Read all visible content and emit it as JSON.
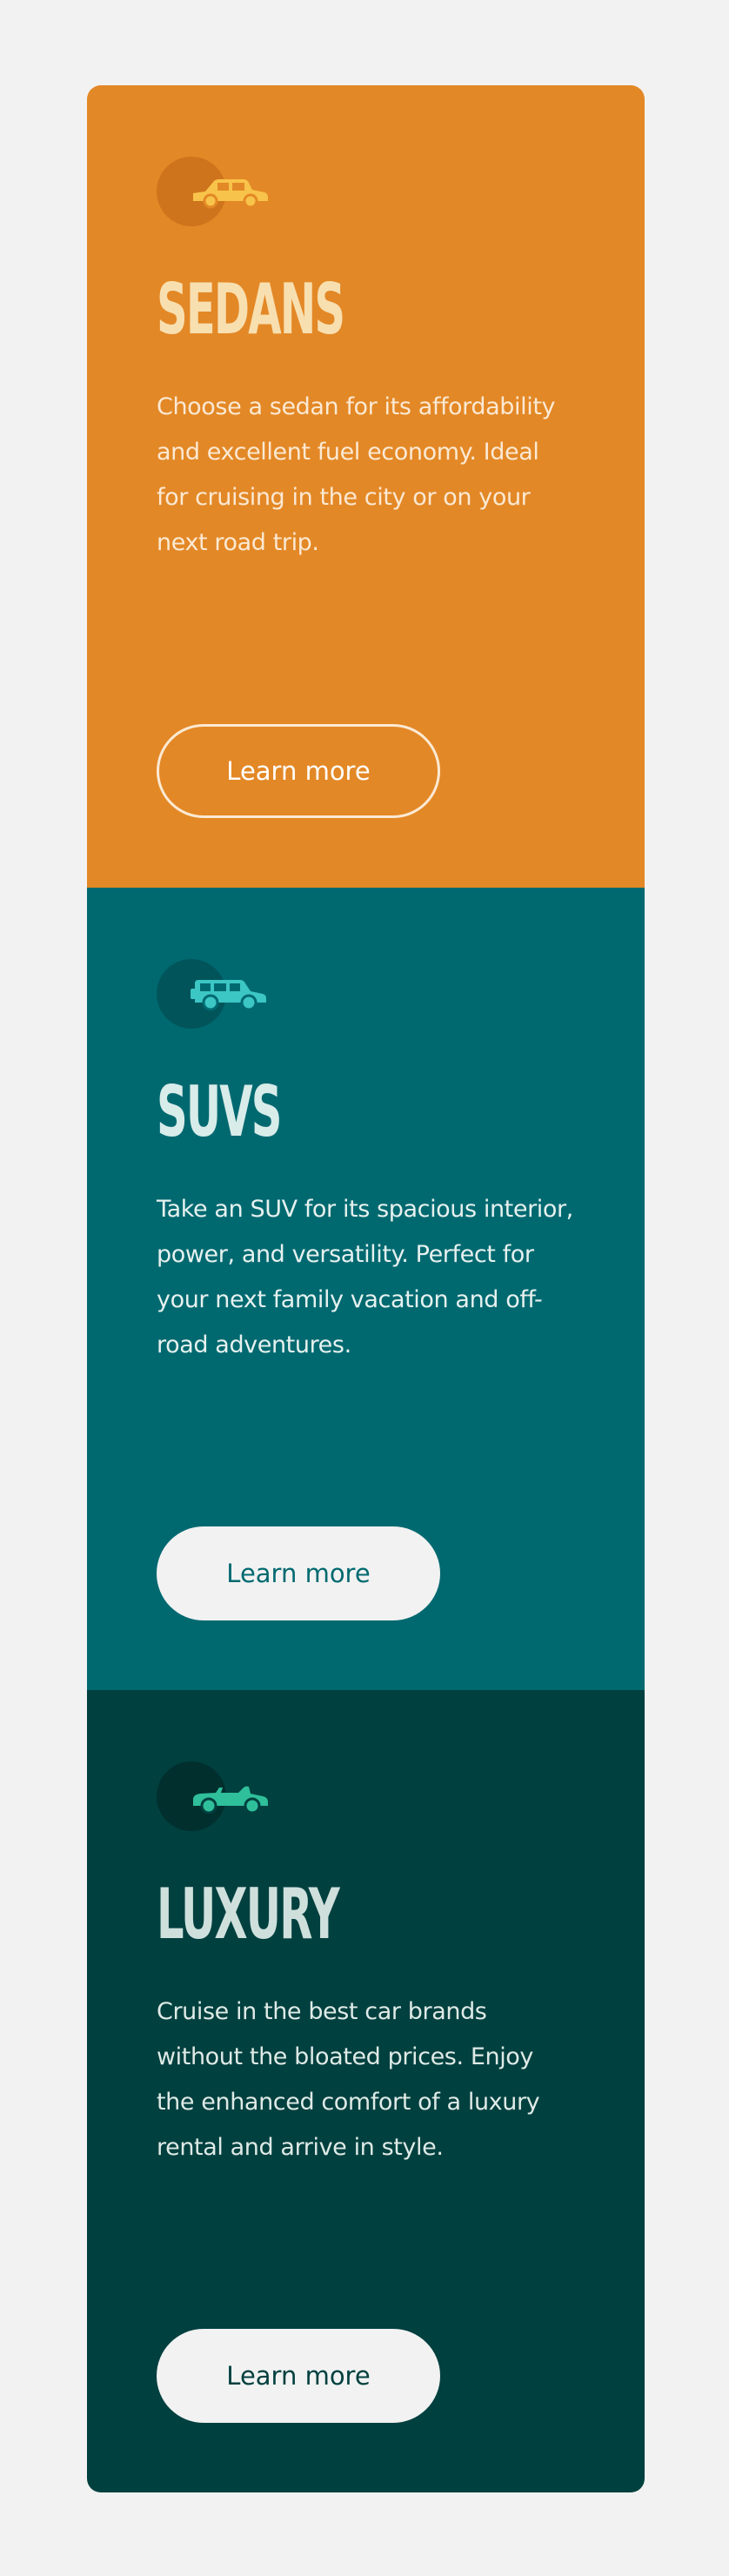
{
  "cards": [
    {
      "title": "SEDANS",
      "description": "Choose a sedan for its affordability and excellent fuel economy. Ideal for cruising in the city or on your next road trip.",
      "button_label": "Learn more",
      "icon": "sedan-icon",
      "color": "#e38826",
      "icon_color": "#f8c34a"
    },
    {
      "title": "SUVS",
      "description": "Take an SUV for its spacious interior, power, and versatility. Perfect for your next family vacation and off-road adventures.",
      "button_label": "Learn more",
      "icon": "suv-icon",
      "color": "#006970",
      "icon_color": "#3cc6c4"
    },
    {
      "title": "LUXURY",
      "description": "Cruise in the best car brands without the bloated prices. Enjoy the enhanced comfort of a luxury rental and arrive in style.",
      "button_label": "Learn more",
      "icon": "convertible-icon",
      "color": "#00403f",
      "icon_color": "#2fbf9a"
    }
  ]
}
